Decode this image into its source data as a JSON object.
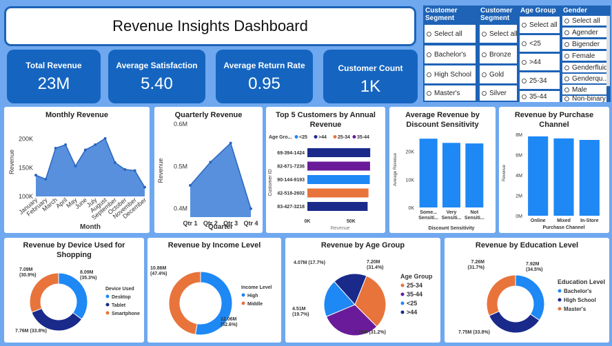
{
  "title": "Revenue Insights Dashboard",
  "kpis": [
    {
      "label": "Total Revenue",
      "value": "23M"
    },
    {
      "label": "Average Satisfaction",
      "value": "5.40"
    },
    {
      "label": "Average Return Rate",
      "value": "0.95"
    },
    {
      "label": "Customer Count",
      "value": "1K"
    }
  ],
  "slicers": [
    {
      "title": "Customer Segment",
      "items": [
        "Select all",
        "Bachelor's",
        "High School",
        "Master's"
      ]
    },
    {
      "title": "Customer Segment",
      "items": [
        "Select all",
        "Bronze",
        "Gold",
        "Silver"
      ]
    },
    {
      "title": "Age Group",
      "items": [
        "Select all",
        "<25",
        ">44",
        "25-34",
        "35-44"
      ]
    },
    {
      "title": "Gender",
      "items": [
        "Select all",
        "Agender",
        "Bigender",
        "Female",
        "Genderfluid",
        "Genderqu...",
        "Male",
        "Non-binary"
      ]
    }
  ],
  "colors": {
    "accent": "#1e63b6",
    "kpi": "#1565c0",
    "bright_blue": "#1e88f5",
    "navy": "#1a2a8a",
    "orange": "#e8743b",
    "purple": "#6a1b9a",
    "area": "#3b7dd8"
  },
  "chart_data": [
    {
      "type": "area",
      "title": "Monthly Revenue",
      "xlabel": "Month",
      "ylabel": "Revenue",
      "categories": [
        "January",
        "February",
        "March",
        "April",
        "May",
        "June",
        "July",
        "August",
        "September",
        "October",
        "November",
        "December"
      ],
      "values": [
        137000,
        130000,
        184000,
        190000,
        153000,
        181000,
        190000,
        201000,
        159000,
        147000,
        145000,
        116000
      ],
      "yticks": [
        "100K",
        "150K",
        "200K"
      ],
      "ylim": [
        100000,
        220000
      ]
    },
    {
      "type": "area",
      "title": "Quarterly Revenue",
      "xlabel": "Quarter",
      "ylabel": "Revenue",
      "categories": [
        "Qtr 1",
        "Qtr 2",
        "Qtr 3",
        "Qtr 4"
      ],
      "values": [
        455000,
        510000,
        555000,
        400000
      ],
      "yticks": [
        "0.4M",
        "0.5M",
        "0.6M"
      ],
      "ylim": [
        380000,
        600000
      ]
    },
    {
      "type": "bar",
      "orientation": "horizontal",
      "title": "Top 5 Customers by Annual Revenue",
      "xlabel": "Revenue",
      "ylabel": "Customer ID",
      "legend_title": "Age Gro...",
      "legend": [
        {
          "name": "<25",
          "color": "#1e88f5"
        },
        {
          "name": ">44",
          "color": "#1a2a8a"
        },
        {
          "name": "25-34",
          "color": "#e8743b"
        },
        {
          "name": "35-44",
          "color": "#6a1b9a"
        }
      ],
      "categories": [
        "69-394-1424",
        "82-671-7236",
        "90-144-9193",
        "42-518-2602",
        "83-427-3218"
      ],
      "values": [
        72000,
        71800,
        71500,
        70000,
        69000
      ],
      "bar_colors": [
        "#1a2a8a",
        "#6a1b9a",
        "#1e88f5",
        "#e8743b",
        "#1a2a8a"
      ],
      "xticks": [
        "0K",
        "50K"
      ],
      "xlim": [
        0,
        75000
      ]
    },
    {
      "type": "bar",
      "title": "Average Revenue by Discount Sensitivity",
      "xlabel": "Discount Sensitivity",
      "ylabel": "Average Revenue",
      "categories": [
        "Some...\nSensiti...",
        "Very\nSensiti...",
        "Not\nSensiti..."
      ],
      "values": [
        24500,
        23000,
        22800
      ],
      "yticks": [
        "0K",
        "10K",
        "20K"
      ],
      "ylim": [
        0,
        27000
      ]
    },
    {
      "type": "bar",
      "title": "Revenue by Purchase Channel",
      "xlabel": "Purchase Channel",
      "ylabel": "Revenue",
      "categories": [
        "Online",
        "Mixed",
        "In-Store"
      ],
      "values": [
        7800000,
        7600000,
        7450000
      ],
      "yticks": [
        "0M",
        "2M",
        "4M",
        "6M",
        "8M"
      ],
      "ylim": [
        0,
        8400000
      ]
    },
    {
      "type": "pie",
      "title": "Revenue by Device Used for Shopping",
      "legend_title": "Device Used",
      "series": [
        {
          "name": "Desktop",
          "value": 8090000,
          "label": "8.09M\n(35.3%)",
          "color": "#1e88f5"
        },
        {
          "name": "Tablet",
          "value": 7760000,
          "label": "7.76M (33.8%)",
          "color": "#1a2a8a"
        },
        {
          "name": "Smartphone",
          "value": 7090000,
          "label": "7.09M\n(30.9%)",
          "color": "#e8743b"
        }
      ]
    },
    {
      "type": "pie",
      "title": "Revenue by Income Level",
      "legend_title": "Income Level",
      "series": [
        {
          "name": "High",
          "value": 12060000,
          "label": "12.06M\n(52.6%)",
          "color": "#1e88f5"
        },
        {
          "name": "Middle",
          "value": 10860000,
          "label": "10.86M\n(47.4%)",
          "color": "#e8743b"
        }
      ]
    },
    {
      "type": "pie",
      "title": "Revenue by Age Group",
      "legend_title": "Age Group",
      "series": [
        {
          "name": "25-34",
          "value": 7200000,
          "label": "7.20M\n(31.4%)",
          "color": "#e8743b"
        },
        {
          "name": "35-44",
          "value": 7150000,
          "label": "7.15M (31.2%)",
          "color": "#6a1b9a"
        },
        {
          "name": "<25",
          "value": 4510000,
          "label": "4.51M\n(19.7%)",
          "color": "#1e88f5"
        },
        {
          "name": ">44",
          "value": 4070000,
          "label": "4.07M (17.7%)",
          "color": "#1a2a8a"
        }
      ]
    },
    {
      "type": "pie",
      "title": "Revenue by Education Level",
      "legend_title": "Education Level",
      "series": [
        {
          "name": "Bachelor's",
          "value": 7920000,
          "label": "7.92M\n(34.5%)",
          "color": "#1e88f5"
        },
        {
          "name": "High School",
          "value": 7750000,
          "label": "7.75M (33.8%)",
          "color": "#1a2a8a"
        },
        {
          "name": "Master's",
          "value": 7260000,
          "label": "7.26M\n(31.7%)",
          "color": "#e8743b"
        }
      ]
    }
  ]
}
